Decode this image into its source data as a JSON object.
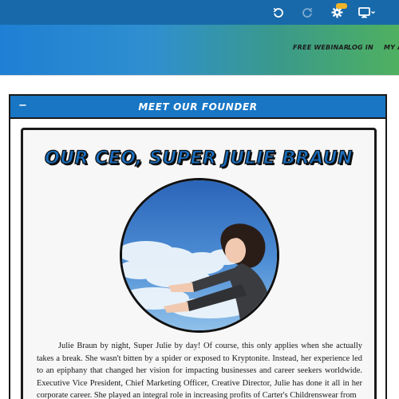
{
  "editor_toolbar": {
    "undo_icon": "undo-icon",
    "redo_icon": "redo-icon",
    "settings_icon": "gear-icon",
    "settings_badge": "",
    "device_icon": "monitor-icon"
  },
  "nav": {
    "free_webinar": "FREE WEBINAR",
    "log_in": "LOG IN",
    "my_account": "MY AC"
  },
  "colors": {
    "toolbar": "#1769aa",
    "section_header": "#1876c4",
    "header_gradient_start": "#1f7fd4",
    "header_gradient_end": "#4fb060"
  },
  "section": {
    "collapse_symbol": "−",
    "title": "MEET OUR FOUNDER"
  },
  "founder": {
    "heading": "OUR CEO, SUPER JULIE BRAUN",
    "bio": "Julie Braun by night, Super Julie by day! Of course, this only applies when she actually takes a break. She wasn't bitten by a spider or exposed to Kryptonite. Instead, her experience led to an epiphany that changed her vision for impacting businesses and career seekers worldwide. Executive Vice President, Chief Marketing Officer, Creative Director, Julie has done it all in her corporate career. She played an integral role in increasing profits of Carter's Childrenswear from"
  }
}
